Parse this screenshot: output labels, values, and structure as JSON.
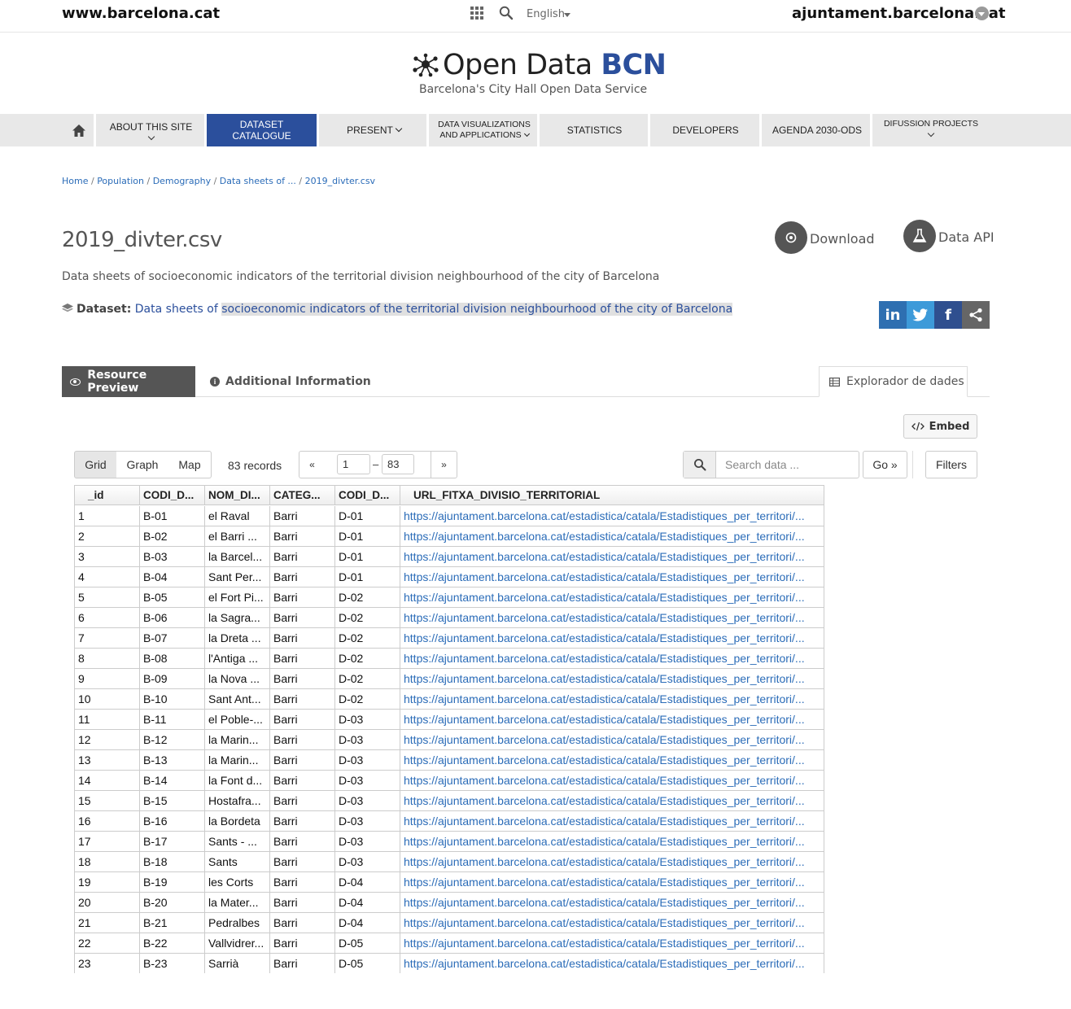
{
  "topbar": {
    "site": "www.barcelona.cat",
    "language": "English",
    "ajuntament": "ajuntament.barcelona.cat"
  },
  "brand": {
    "name_regular": "Open Data ",
    "name_bold": "BCN",
    "tagline": "Barcelona's City Hall Open Data Service",
    "accent_color": "#2b4f9c"
  },
  "nav": {
    "home_icon": "home-icon",
    "items": [
      {
        "line1": "ABOUT THIS SITE",
        "line2": ""
      },
      {
        "line1": "DATASET",
        "line2": "CATALOGUE"
      },
      {
        "line1": "PRESENT",
        "line2": ""
      },
      {
        "line1": "DATA VISUALIZATIONS",
        "line2": "AND APPLICATIONS"
      },
      {
        "line1": "STATISTICS",
        "line2": ""
      },
      {
        "line1": "DEVELOPERS",
        "line2": ""
      },
      {
        "line1": "AGENDA 2030-ODS",
        "line2": ""
      },
      {
        "line1": "DIFUSSION PROJECTS",
        "line2": ""
      }
    ]
  },
  "breadcrumb": [
    "Home",
    "Population",
    "Demography",
    "Data sheets of ...",
    "2019_divter.csv"
  ],
  "page": {
    "title": "2019_divter.csv",
    "description": "Data sheets of socioeconomic indicators of the territorial division neighbourhood of the city of Barcelona",
    "dataset_label": "Dataset:",
    "dataset_link_a": "Data sheets of ",
    "dataset_link_b": "socioeconomic indicators of the territorial division neighbourhood of the city of Barcelona",
    "download": "Download",
    "data_api": "Data API"
  },
  "social": {
    "linkedin": "in",
    "facebook": "f"
  },
  "tabs": {
    "preview": "Resource Preview",
    "info": "Additional Information",
    "explorer": "Explorador de dades"
  },
  "explorer": {
    "embed": "Embed",
    "views": [
      "Grid",
      "Graph",
      "Map"
    ],
    "records": "83 records",
    "prev": "«",
    "next": "»",
    "page_from": "1",
    "page_to": "83",
    "dash": "–",
    "search_placeholder": "Search data ...",
    "go": "Go »",
    "filters": "Filters"
  },
  "table": {
    "columns": [
      "_id",
      "CODI_D...",
      "NOM_DI...",
      "CATEG...",
      "CODI_D...",
      "URL_FITXA_DIVISIO_TERRITORIAL"
    ],
    "url_text": "https://ajuntament.barcelona.cat/estadistica/catala/Estadistiques_per_territori/...",
    "rows": [
      [
        "1",
        "B-01",
        "el Raval",
        "Barri",
        "D-01"
      ],
      [
        "2",
        "B-02",
        "el Barri ...",
        "Barri",
        "D-01"
      ],
      [
        "3",
        "B-03",
        "la Barcel...",
        "Barri",
        "D-01"
      ],
      [
        "4",
        "B-04",
        "Sant Per...",
        "Barri",
        "D-01"
      ],
      [
        "5",
        "B-05",
        "el Fort Pi...",
        "Barri",
        "D-02"
      ],
      [
        "6",
        "B-06",
        "la Sagra...",
        "Barri",
        "D-02"
      ],
      [
        "7",
        "B-07",
        "la Dreta ...",
        "Barri",
        "D-02"
      ],
      [
        "8",
        "B-08",
        "l'Antiga ...",
        "Barri",
        "D-02"
      ],
      [
        "9",
        "B-09",
        "la Nova ...",
        "Barri",
        "D-02"
      ],
      [
        "10",
        "B-10",
        "Sant Ant...",
        "Barri",
        "D-02"
      ],
      [
        "11",
        "B-11",
        "el Poble-...",
        "Barri",
        "D-03"
      ],
      [
        "12",
        "B-12",
        "la Marin...",
        "Barri",
        "D-03"
      ],
      [
        "13",
        "B-13",
        "la Marin...",
        "Barri",
        "D-03"
      ],
      [
        "14",
        "B-14",
        "la Font d...",
        "Barri",
        "D-03"
      ],
      [
        "15",
        "B-15",
        "Hostafra...",
        "Barri",
        "D-03"
      ],
      [
        "16",
        "B-16",
        "la Bordeta",
        "Barri",
        "D-03"
      ],
      [
        "17",
        "B-17",
        "Sants - ...",
        "Barri",
        "D-03"
      ],
      [
        "18",
        "B-18",
        "Sants",
        "Barri",
        "D-03"
      ],
      [
        "19",
        "B-19",
        "les Corts",
        "Barri",
        "D-04"
      ],
      [
        "20",
        "B-20",
        "la Mater...",
        "Barri",
        "D-04"
      ],
      [
        "21",
        "B-21",
        "Pedralbes",
        "Barri",
        "D-04"
      ],
      [
        "22",
        "B-22",
        "Vallvidrer...",
        "Barri",
        "D-05"
      ],
      [
        "23",
        "B-23",
        "Sarrià",
        "Barri",
        "D-05"
      ]
    ]
  }
}
